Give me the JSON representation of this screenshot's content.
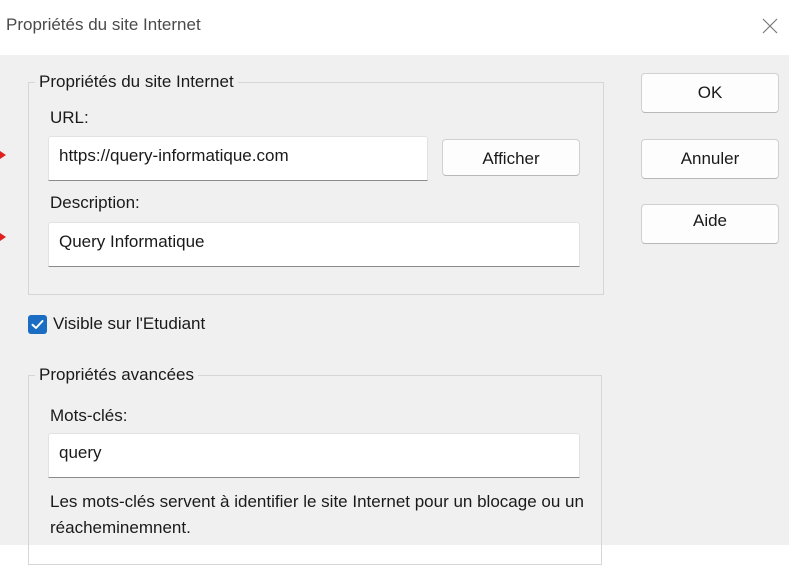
{
  "window": {
    "title": "Propriétés du site Internet"
  },
  "site_group": {
    "legend": "Propriétés du site Internet",
    "url_label": "URL:",
    "url_value": "https://query-informatique.com",
    "show_button": "Afficher",
    "description_label": "Description:",
    "description_value": "Query Informatique"
  },
  "visible_checkbox": {
    "label": "Visible sur l'Etudiant",
    "checked": true
  },
  "advanced_group": {
    "legend": "Propriétés avancées",
    "keywords_label": "Mots-clés:",
    "keywords_value": "query",
    "help_text": "Les mots-clés servent à identifier le site Internet pour un blocage ou un réacheminemnent."
  },
  "buttons": {
    "ok": "OK",
    "cancel": "Annuler",
    "help": "Aide"
  },
  "colors": {
    "accent": "#1a6dc2",
    "annotation_arrow": "#e02020"
  },
  "icons": {
    "close": "close-icon",
    "check": "check-icon"
  }
}
